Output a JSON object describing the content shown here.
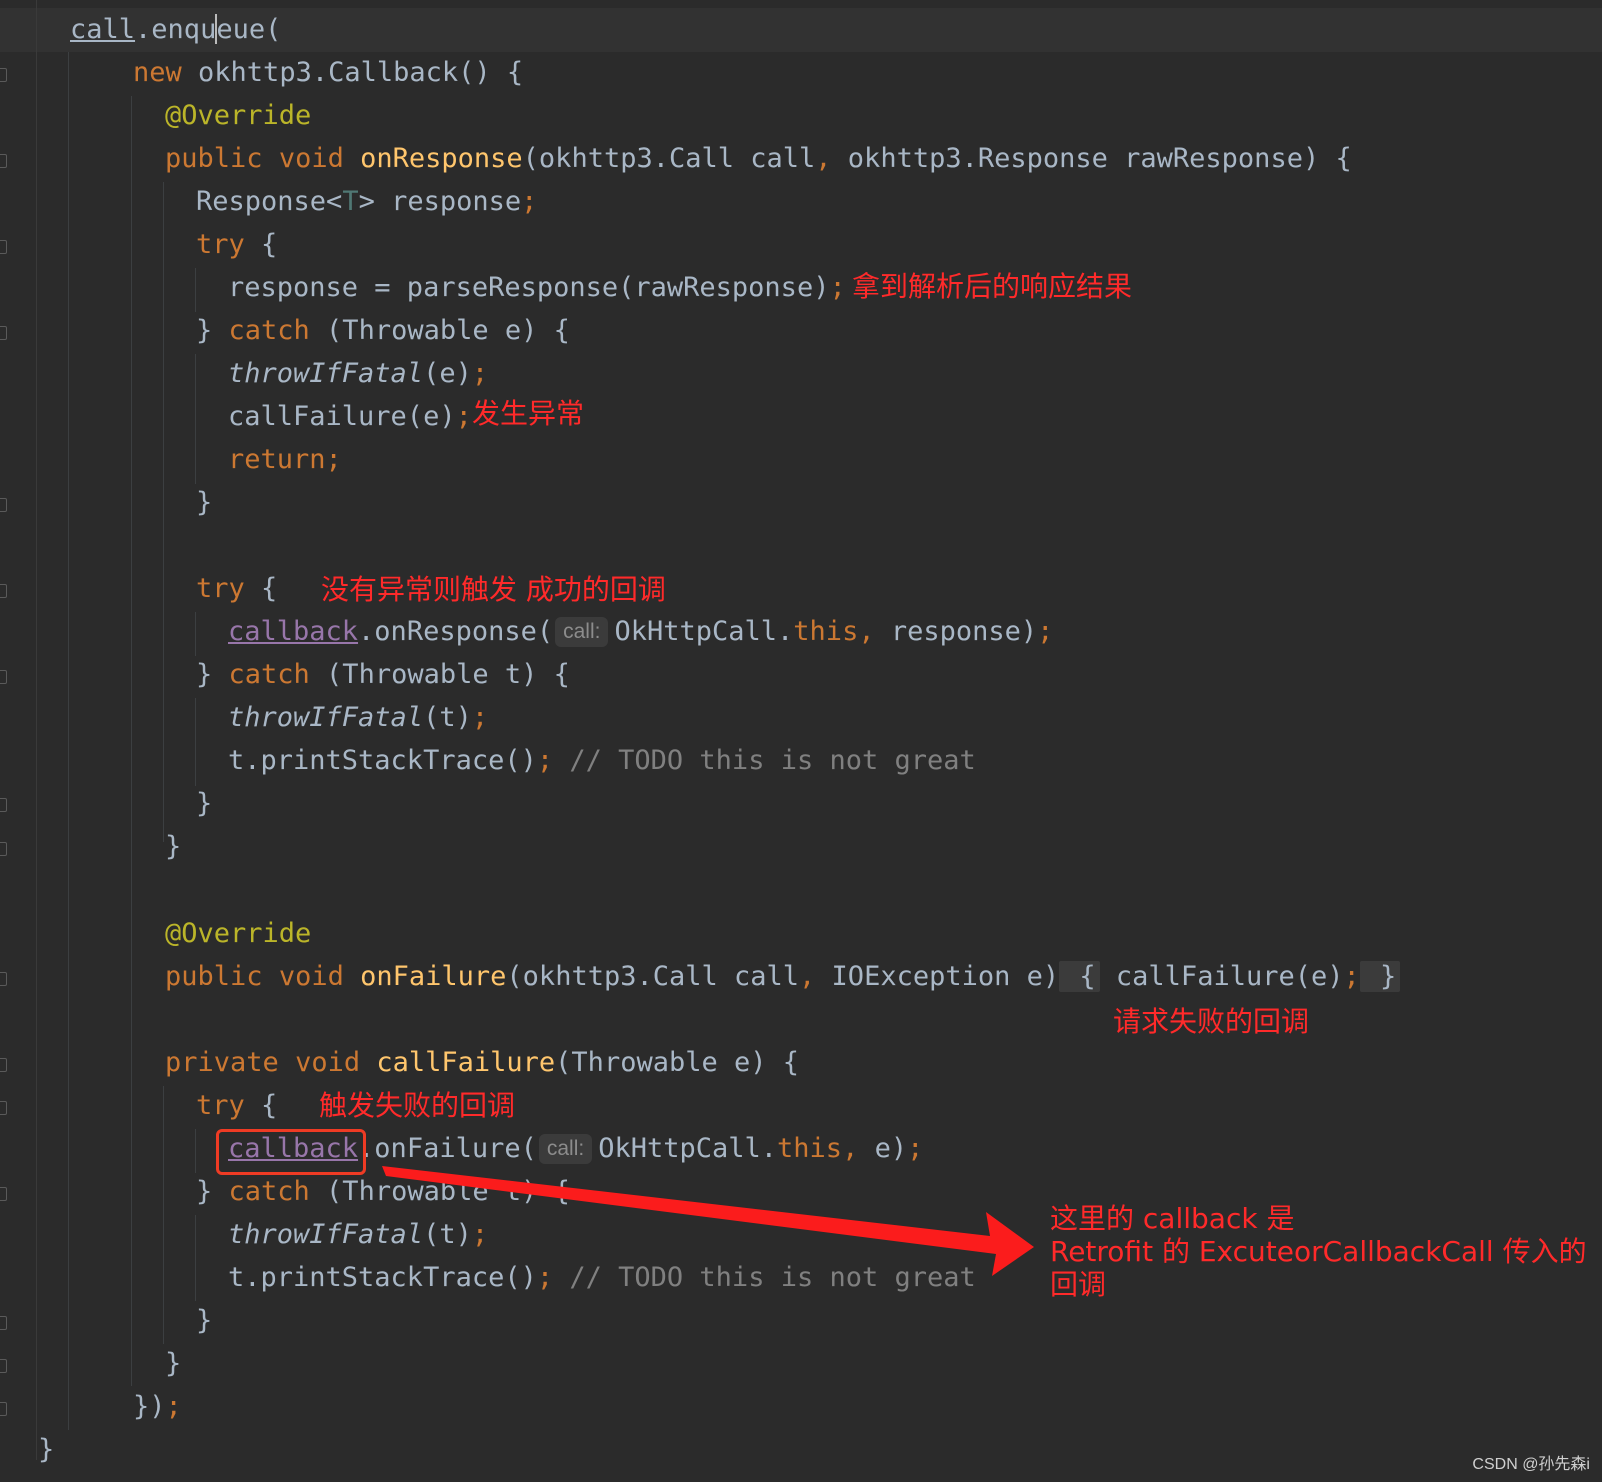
{
  "code": {
    "l1": {
      "receiver": "call",
      "dot": ".",
      "method_a": "enqu",
      "method_b": "eue",
      "paren": "("
    },
    "l2": {
      "new": "new",
      "rest": " okhttp3.Callback() {"
    },
    "l3": {
      "annotation": "@Override"
    },
    "l4": {
      "public": "public",
      "void": "void",
      "name": "onResponse",
      "params_a": "(okhttp3.Call call",
      "comma": ",",
      "params_b": " okhttp3.Response rawResponse) {"
    },
    "l5": {
      "type_a": "Response<",
      "type_param": "T",
      "type_b": "> response",
      "semi": ";"
    },
    "l6": {
      "try": "try",
      "brace": " {"
    },
    "l7": {
      "code": "response = parseResponse(rawResponse)",
      "semi": ";"
    },
    "l8": {
      "close": "} ",
      "catch": "catch",
      "rest": " (Throwable e) {"
    },
    "l9": {
      "fn": "throwIfFatal",
      "args": "(e)",
      "semi": ";"
    },
    "l10": {
      "code": "callFailure(e)",
      "semi": ";"
    },
    "l11": {
      "ret": "return",
      "semi": ";"
    },
    "l12": {
      "close": "}"
    },
    "l13": {
      "try": "try",
      "brace": " {"
    },
    "l14": {
      "field": "callback",
      "call": ".onResponse(",
      "hint": "call:",
      "arg_a": "OkHttpCall.",
      "this": "this",
      "comma": ",",
      "arg_b": " response)",
      "semi": ";"
    },
    "l15": {
      "close": "} ",
      "catch": "catch",
      "rest": " (Throwable t) {"
    },
    "l16": {
      "fn": "throwIfFatal",
      "args": "(t)",
      "semi": ";"
    },
    "l17": {
      "code": "t.printStackTrace()",
      "semi": ";",
      "comment": " // TODO this is not great"
    },
    "l18": {
      "close": "}"
    },
    "l19": {
      "close": "}"
    },
    "l20": {
      "annotation": "@Override"
    },
    "l21": {
      "public": "public",
      "void": "void",
      "name": "onFailure",
      "params_a": "(okhttp3.Call call",
      "comma": ",",
      "params_b": " IOException e)",
      "fold_open": " {",
      "body": " callFailure(e)",
      "semi": ";",
      "fold_close": " }"
    },
    "l22": {
      "private": "private",
      "void": "void",
      "name": "callFailure",
      "params": "(Throwable e) {"
    },
    "l23": {
      "try": "try",
      "brace": " {"
    },
    "l24": {
      "field": "callback",
      "call": ".onFailure(",
      "hint": "call:",
      "arg_a": "OkHttpCall.",
      "this": "this",
      "comma": ",",
      "arg_b": " e)",
      "semi": ";"
    },
    "l25": {
      "close": "} ",
      "catch": "catch",
      "rest": " (Throwable t) {"
    },
    "l26": {
      "fn": "throwIfFatal",
      "args": "(t)",
      "semi": ";"
    },
    "l27": {
      "code": "t.printStackTrace()",
      "semi": ";",
      "comment": " // TODO this is not great"
    },
    "l28": {
      "close": "}"
    },
    "l29": {
      "close": "}"
    },
    "l30": {
      "close": "})",
      "semi": ";"
    },
    "l31": {
      "close": "}"
    }
  },
  "annotations": {
    "parsed_result": "拿到解析后的响应结果",
    "exception": "发生异常",
    "success_callback": "没有异常则触发 成功的回调",
    "failure_callback_request": "请求失败的回调",
    "failure_callback_trigger": "触发失败的回调",
    "callback_origin_line1": "这里的 callback 是",
    "callback_origin_line2": "Retrofit 的 ExcuteorCallbackCall 传入的",
    "callback_origin_line3": "回调"
  },
  "watermark": "CSDN @孙先森i",
  "colors": {
    "background": "#2b2b2b",
    "keyword": "#cc7832",
    "method": "#ffc66d",
    "annotation": "#bbb529",
    "field": "#9876aa",
    "default_text": "#a9b7c6",
    "comment": "#808080",
    "note_red": "#ff2a2a"
  }
}
